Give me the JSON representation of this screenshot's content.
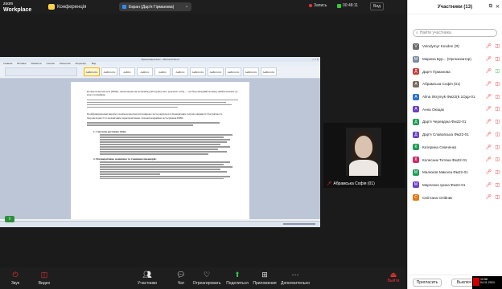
{
  "app": {
    "brand_small": "zoom",
    "brand_large": "Workplace",
    "conference_label": "Конференція"
  },
  "header": {
    "screen_share_label": "Екран (Дар'я Гірманова)",
    "recording_label": "Запись",
    "timer": "00:48:11",
    "view_label": "Вид"
  },
  "shared_document": {
    "window_title": "Презентація.docx - Microsoft Word",
    "tabs": [
      "Главная",
      "Вставка",
      "Разметка",
      "Ссылки",
      "Рассылки",
      "Рецензир.",
      "Вид"
    ],
    "styles": [
      "AaBbCcDc",
      "AaBbCcDc",
      "AaBbC",
      "AaBbCc",
      "AaBbC",
      "AaBbCc",
      "AaBbCcDc",
      "AaBbCcDc",
      "AaBbCcDc",
      "AaBbCcDc",
      "AaBbCcDc"
    ],
    "para1": "Полімолочна кислота (PMK), також відома як полілактид (PLA) (від англ. polylactic acid), — це біорозкладний полімер, який належить до класу поліефірів.",
    "para2": "Поліфункціональні вироби з полімолочної кислоти широко застосовуються в біомедичних галузях завдяки їх біосумісності, біорозкладності та механічним характеристикам. Основні напрямки застосування ПМК:",
    "h1": "1. Системи доставки ліків:",
    "h2": "2. Регенеративна медицина та тканинна інженерія:"
  },
  "participant_tile": {
    "name": "Абрамська Софія (01)"
  },
  "toolbar": {
    "items": [
      {
        "label": "Звук"
      },
      {
        "label": "Видео"
      },
      {
        "label": "Участники",
        "count": "13"
      },
      {
        "label": "Чат"
      },
      {
        "label": "Отреагировать"
      },
      {
        "label": "Поделиться"
      },
      {
        "label": "Приложения"
      },
      {
        "label": "Дополнительно"
      }
    ],
    "leave_label": "Выйти"
  },
  "panel": {
    "title": "Участники (13)",
    "search_placeholder": "Найти участника",
    "participants": [
      {
        "name": "Volodymyr Kovden (Я)",
        "color": "#6d6d6d",
        "initial": "V",
        "cam_on": false
      },
      {
        "name": "Марина Бур... (Организатор)",
        "color": "#7a8c9e",
        "initial": "М",
        "cam_on": false
      },
      {
        "name": "Дар'я Гірманова",
        "color": "#c43d3d",
        "initial": "Д",
        "cam_on": true
      },
      {
        "name": "Абрамська Софія (01)",
        "color": "#7a6a5e",
        "initial": "А",
        "cam_on": false
      },
      {
        "name": "Alina Skrymyk Фм22(К.1Одр-01",
        "color": "#2c6fd6",
        "initial": "A",
        "cam_on": false
      },
      {
        "name": "Анна Окіщак",
        "color": "#6a3fc9",
        "initial": "А",
        "cam_on": false
      },
      {
        "name": "Дар'я Черевдіна Фм22-01",
        "color": "#1f9d55",
        "initial": "Д",
        "cam_on": false
      },
      {
        "name": "Дар'я Славовська Фм22-01",
        "color": "#6a3fc9",
        "initial": "Д",
        "cam_on": false
      },
      {
        "name": "Катерина Семченко",
        "color": "#1f9d55",
        "initial": "К",
        "cam_on": false
      },
      {
        "name": "Колесник Тетяна Фм22-01",
        "color": "#d02a6a",
        "initial": "К",
        "cam_on": false
      },
      {
        "name": "Малюков Микола Фм22-01",
        "color": "#1f9d55",
        "initial": "М",
        "cam_on": false
      },
      {
        "name": "Марченко Ірина Фм22-01",
        "color": "#6a3fc9",
        "initial": "М",
        "cam_on": false
      },
      {
        "name": "Світлана Олійник",
        "color": "#e07a12",
        "initial": "С",
        "cam_on": false
      }
    ],
    "invite_label": "Пригласить",
    "mute_all_label": "Выключ..."
  },
  "tray": {
    "time": "12:56",
    "date": "04.11.2024"
  }
}
